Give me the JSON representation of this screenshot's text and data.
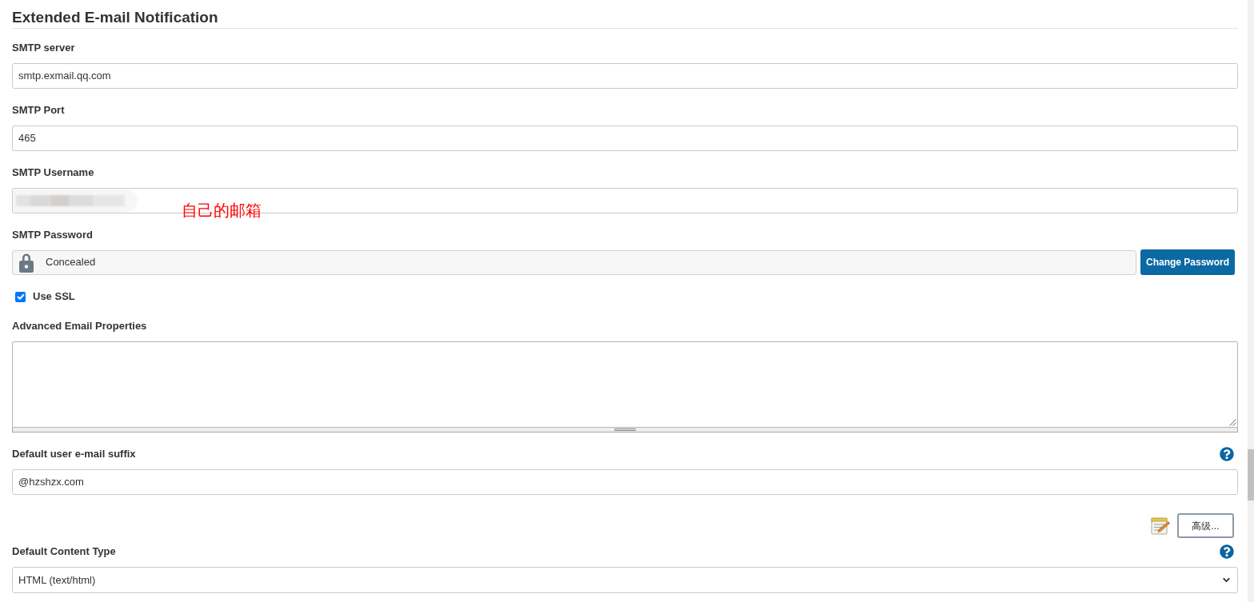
{
  "section": {
    "title": "Extended E-mail Notification"
  },
  "fields": [
    {
      "kind": "text",
      "label": "SMTP server",
      "value": "smtp.exmail.qq.com"
    },
    {
      "kind": "text",
      "label": "SMTP Port",
      "value": "465"
    },
    {
      "kind": "text",
      "label": "SMTP Username",
      "redacted": true,
      "annotation": "自己的邮箱"
    },
    {
      "kind": "password",
      "label": "SMTP Password",
      "value": "Concealed",
      "button": "Change Password"
    },
    {
      "kind": "checkbox",
      "label": "Use SSL",
      "checked": true
    },
    {
      "kind": "textarea",
      "label": "Advanced Email Properties"
    },
    {
      "kind": "text",
      "label": "Default user e-mail suffix",
      "value": "@hzshzx.com",
      "help": true
    },
    {
      "kind": "advanced",
      "button": "高级..."
    },
    {
      "kind": "select",
      "label": "Default Content Type",
      "value": "HTML (text/html)",
      "help": true
    }
  ]
}
